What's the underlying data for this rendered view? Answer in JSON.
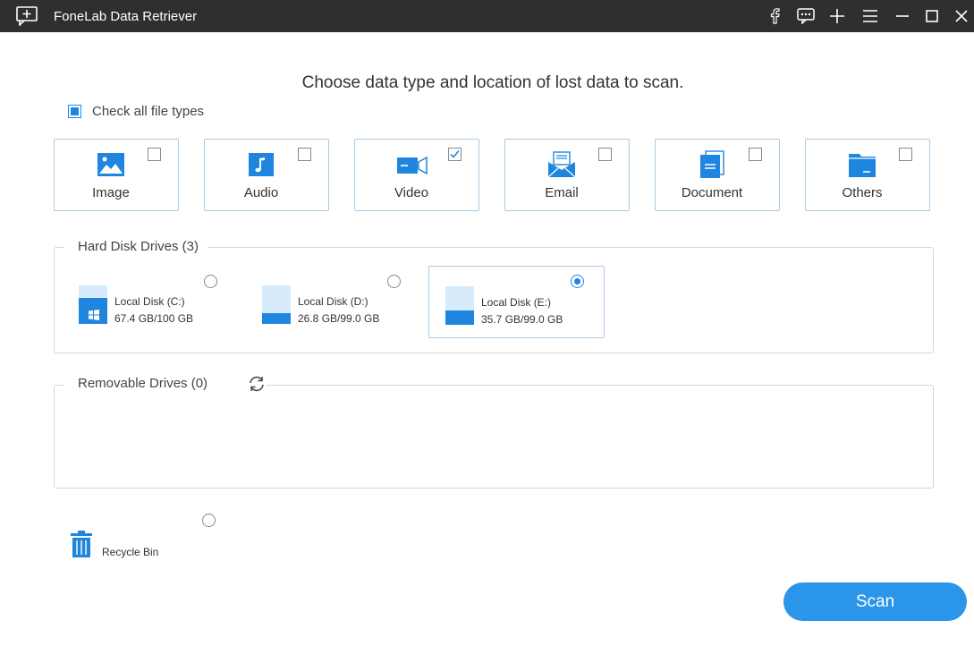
{
  "window": {
    "title": "FoneLab Data Retriever",
    "controls": [
      "facebook-icon",
      "feedback-icon",
      "plus-icon",
      "menu-icon",
      "minimize-icon",
      "maximize-icon",
      "close-icon"
    ]
  },
  "main": {
    "heading": "Choose data type and location of lost data to scan.",
    "check_all": {
      "label": "Check all file types",
      "state": "partial"
    }
  },
  "file_types": [
    {
      "label": "Image",
      "icon": "image-icon",
      "checked": false
    },
    {
      "label": "Audio",
      "icon": "music-note-icon",
      "checked": false
    },
    {
      "label": "Video",
      "icon": "video-camera-icon",
      "checked": true
    },
    {
      "label": "Email",
      "icon": "envelope-icon",
      "checked": false
    },
    {
      "label": "Document",
      "icon": "document-icon",
      "checked": false
    },
    {
      "label": "Others",
      "icon": "folder-icon",
      "checked": false
    }
  ],
  "hard_disk": {
    "title": "Hard Disk Drives (3)",
    "drives": [
      {
        "name": "Local Disk (C:)",
        "size": "67.4 GB/100 GB",
        "used_fraction": 0.674,
        "system": true,
        "selected": false
      },
      {
        "name": "Local Disk (D:)",
        "size": "26.8 GB/99.0 GB",
        "used_fraction": 0.271,
        "system": false,
        "selected": false
      },
      {
        "name": "Local Disk (E:)",
        "size": "35.7 GB/99.0 GB",
        "used_fraction": 0.361,
        "system": false,
        "selected": true
      }
    ]
  },
  "removable": {
    "title": "Removable Drives (0)",
    "refresh_icon": "refresh-icon"
  },
  "recycle_bin": {
    "label": "Recycle Bin",
    "icon": "trash-icon",
    "selected": false
  },
  "scan_button": {
    "label": "Scan"
  },
  "colors": {
    "accent": "#1f86e0",
    "button": "#2b95e9",
    "titlebar": "#2f2f2f",
    "tile_border": "#a9cbe4"
  }
}
